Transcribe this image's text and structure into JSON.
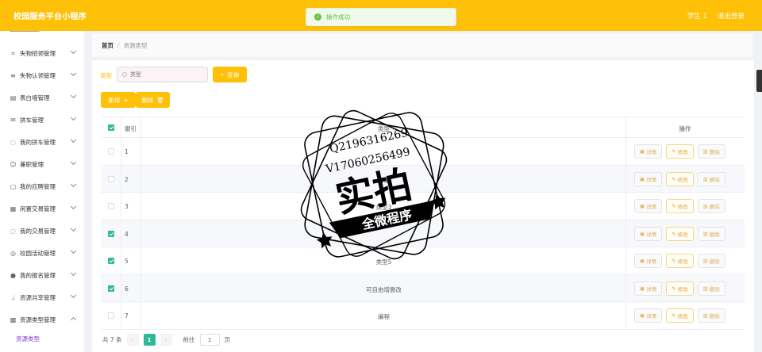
{
  "app": {
    "title": "校园服务平台小程序",
    "user": "学生 1",
    "logout": "退出登录"
  },
  "toast": {
    "message": "操作成功"
  },
  "sidebar": {
    "items": [
      {
        "label": "失物招领管理",
        "icon": "crop-icon"
      },
      {
        "label": "失物认领管理",
        "icon": "list-icon"
      },
      {
        "label": "表白墙管理",
        "icon": "board-icon"
      },
      {
        "label": "拼车管理",
        "icon": "mail-icon"
      },
      {
        "label": "我的拼车管理",
        "icon": "chat-icon"
      },
      {
        "label": "兼职管理",
        "icon": "user-icon"
      },
      {
        "label": "我的应聘管理",
        "icon": "doc-icon"
      },
      {
        "label": "闲置交易管理",
        "icon": "grid-icon"
      },
      {
        "label": "我的交易管理",
        "icon": "chat-icon"
      },
      {
        "label": "校园活动管理",
        "icon": "compass-icon"
      },
      {
        "label": "我的报名管理",
        "icon": "person-icon"
      },
      {
        "label": "资源共享管理",
        "icon": "mic-icon"
      },
      {
        "label": "资源类型管理",
        "icon": "apps-icon"
      }
    ],
    "sub_item": "资源类型"
  },
  "breadcrumb": {
    "home": "首页",
    "sep": "/",
    "current": "资源类型"
  },
  "search": {
    "label": "类型",
    "placeholder": "类型",
    "button": "查询"
  },
  "actions": {
    "add": "新增",
    "delete": "删除"
  },
  "table": {
    "headers": {
      "index": "索引",
      "type": "类型",
      "ops": "操作"
    },
    "rows": [
      {
        "index": "1",
        "type": "",
        "checked": false
      },
      {
        "index": "2",
        "type": "类型",
        "checked": false
      },
      {
        "index": "3",
        "type": "类型3",
        "checked": false
      },
      {
        "index": "4",
        "type": "",
        "checked": true
      },
      {
        "index": "5",
        "type": "类型5",
        "checked": true
      },
      {
        "index": "6",
        "type": "可自由增删改",
        "checked": true
      },
      {
        "index": "7",
        "type": "编程",
        "checked": false
      }
    ],
    "op_labels": {
      "detail": "详情",
      "edit": "修改",
      "remove": "删除"
    }
  },
  "pagination": {
    "total": "共 7 条",
    "prev": "‹",
    "page": "1",
    "next": "›",
    "goto_label": "前往",
    "goto_value": "1",
    "goto_suffix": "页"
  },
  "watermark": {
    "line1": "Q2196316269",
    "line2": "V17060256499",
    "big": "实拍",
    "banner": "全微程序"
  },
  "colors": {
    "primary": "#ffc107",
    "accent": "#2fb99a",
    "success": "#67c23a"
  }
}
